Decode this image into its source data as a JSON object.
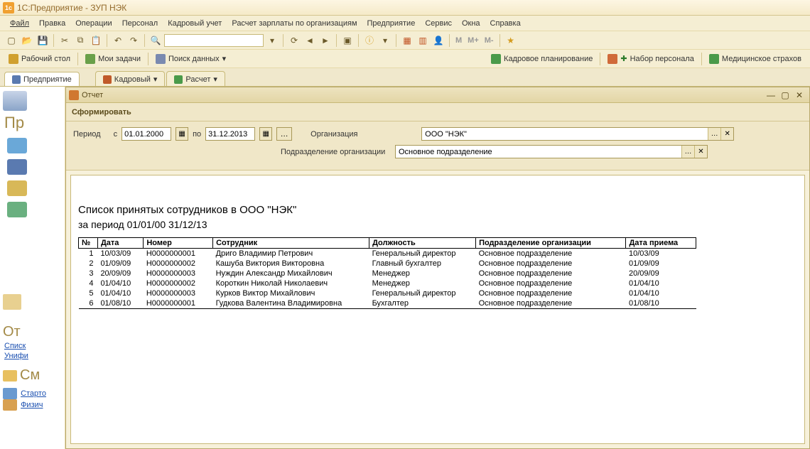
{
  "app": {
    "title": "1С:Предприятие - ЗУП НЭК"
  },
  "menu": [
    "Файл",
    "Правка",
    "Операции",
    "Персонал",
    "Кадровый учет",
    "Расчет зарплаты по организациям",
    "Предприятие",
    "Сервис",
    "Окна",
    "Справка"
  ],
  "panelbar": {
    "desktop": "Рабочий стол",
    "tasks": "Мои задачи",
    "search": "Поиск данных",
    "right": [
      "Кадровое планирование",
      "Набор персонала",
      "Медицинское страхов"
    ]
  },
  "tabs": {
    "main": "Предприятие",
    "items": [
      "Кадровый",
      "Расчет"
    ]
  },
  "leftstrip": {
    "title": "Пр",
    "section1": "От",
    "links": [
      "Списк",
      "Унифи"
    ],
    "section2": "См",
    "bottom": [
      "Старто",
      "Физич"
    ]
  },
  "report": {
    "title": "Отчет",
    "form_btn": "Сформировать",
    "params": {
      "period_label": "Период",
      "from_label": "с",
      "to_label": "по",
      "date_from": "01.01.2000",
      "date_to": "31.12.2013",
      "org_label": "Организация",
      "org_value": "ООО \"НЭК\"",
      "dept_label": "Подразделение организации",
      "dept_value": "Основное подразделение"
    },
    "heading": "Список принятых сотрудников в ООО \"НЭК\"",
    "subheading": "за период 01/01/00     31/12/13",
    "columns": [
      "№",
      "Дата",
      "Номер",
      "Сотрудник",
      "Должность",
      "Подразделение организации",
      "Дата приема"
    ],
    "rows": [
      {
        "n": "1",
        "date": "10/03/09",
        "num": "Н0000000001",
        "emp": "Дриго Владимир Петрович",
        "pos": "Генеральный директор",
        "dept": "Основное подразделение",
        "hire": "10/03/09"
      },
      {
        "n": "2",
        "date": "01/09/09",
        "num": "Н0000000002",
        "emp": "Кашуба Виктория Викторовна",
        "pos": "Главный бухгалтер",
        "dept": "Основное подразделение",
        "hire": "01/09/09"
      },
      {
        "n": "3",
        "date": "20/09/09",
        "num": "Н0000000003",
        "emp": "Нуждин Александр Михайлович",
        "pos": "Менеджер",
        "dept": "Основное подразделение",
        "hire": "20/09/09"
      },
      {
        "n": "4",
        "date": "01/04/10",
        "num": "Н0000000002",
        "emp": "Короткин Николай Николаевич",
        "pos": "Менеджер",
        "dept": "Основное подразделение",
        "hire": "01/04/10"
      },
      {
        "n": "5",
        "date": "01/04/10",
        "num": "Н0000000003",
        "emp": "Курков Виктор Михайлович",
        "pos": "Генеральный директор",
        "dept": "Основное подразделение",
        "hire": "01/04/10"
      },
      {
        "n": "6",
        "date": "01/08/10",
        "num": "Н0000000001",
        "emp": "Гудкова Валентина Владимировна",
        "pos": "Бухгалтер",
        "dept": "Основное подразделение",
        "hire": "01/08/10"
      }
    ]
  }
}
